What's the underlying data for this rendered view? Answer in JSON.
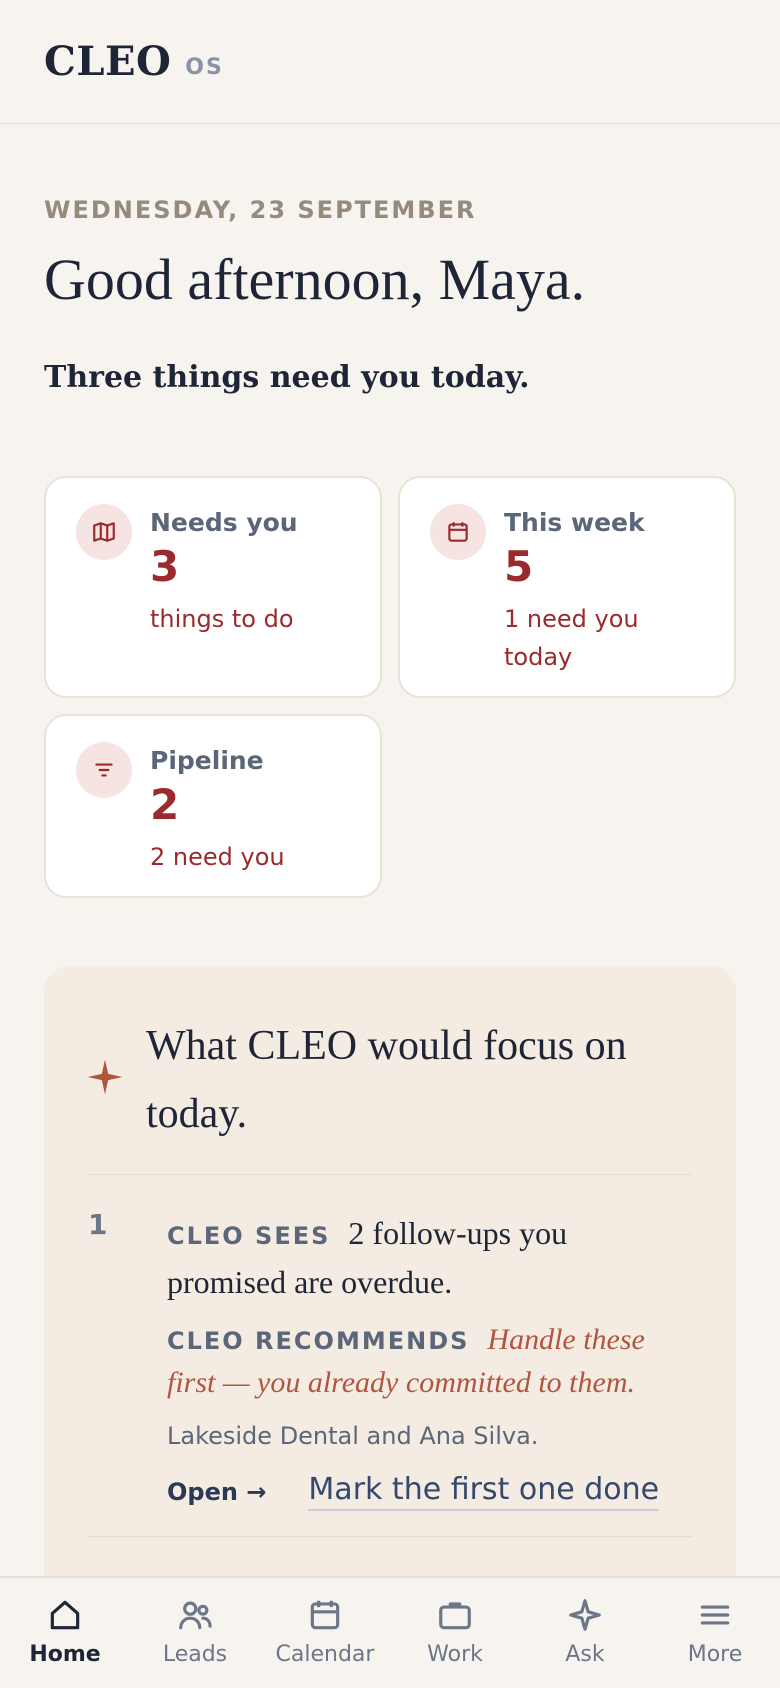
{
  "header": {
    "brand": "CLEO",
    "brand_sub": "OS"
  },
  "greeting": {
    "date": "WEDNESDAY, 23 SEPTEMBER",
    "title": "Good afternoon, Maya.",
    "subtitle": "Three things need you today."
  },
  "cards": [
    {
      "title": "Needs you",
      "value": "3",
      "desc": "things to do",
      "icon": "map-icon"
    },
    {
      "title": "This week",
      "value": "5",
      "desc": "1 need you today",
      "icon": "calendar-icon"
    },
    {
      "title": "Pipeline",
      "value": "2",
      "desc": "2 need you",
      "icon": "filter-icon"
    }
  ],
  "focus": {
    "title": "What CLEO would focus on today.",
    "icon": "sparkle-icon",
    "items": [
      {
        "number": "1",
        "sees_label": "CLEO SEES",
        "sees_text": "2 follow-ups you promised are overdue.",
        "recommends_label": "CLEO RECOMMENDS",
        "recommends_text": "Handle these first — you already committed to them.",
        "detail": "Lakeside Dental and Ana Silva.",
        "open_label": "Open →",
        "done_label": "Mark the first one done"
      }
    ]
  },
  "nav": [
    {
      "label": "Home",
      "icon": "home-icon",
      "active": true
    },
    {
      "label": "Leads",
      "icon": "users-icon"
    },
    {
      "label": "Calendar",
      "icon": "calendar-icon"
    },
    {
      "label": "Work",
      "icon": "briefcase-icon"
    },
    {
      "label": "Ask",
      "icon": "sparkle-icon"
    },
    {
      "label": "More",
      "icon": "menu-icon"
    }
  ],
  "colors": {
    "accent": "#9b2a2e",
    "ink": "#1d2536",
    "muted": "#5b6679",
    "background": "#f7f4ef",
    "focus_bg": "#f4ebe3",
    "sparkle": "#b0553e"
  }
}
